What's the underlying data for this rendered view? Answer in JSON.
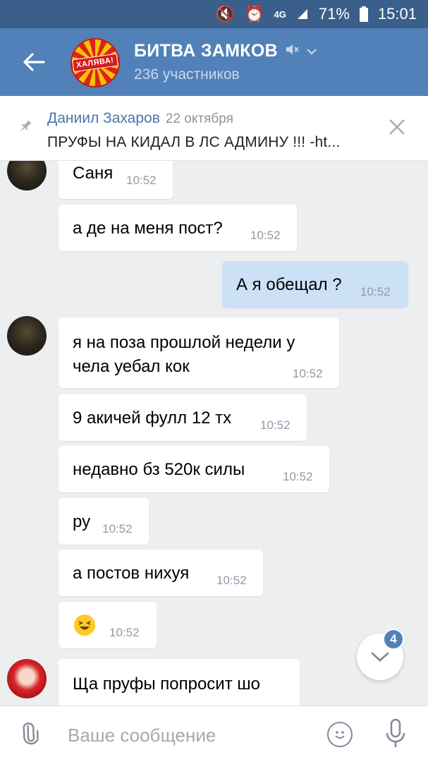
{
  "status": {
    "battery": "71%",
    "time": "15:01",
    "network": "4G"
  },
  "header": {
    "title": "БИТВА ЗАМКОВ",
    "subtitle": "236 участников",
    "avatar_text": "ХАЛЯВА!"
  },
  "pinned": {
    "author": "Даниил Захаров",
    "date": "22 октября",
    "text": "ПРУФЫ НА КИДАЛ В ЛС АДМИНУ !!! -ht..."
  },
  "messages": [
    {
      "text": "Саня",
      "time": "10:52"
    },
    {
      "text": "а де на меня пост?",
      "time": "10:52"
    },
    {
      "text": "А я обещал ?",
      "time": "10:52"
    },
    {
      "text_line1": "я на поза прошлой недели у",
      "text_line2": "чела уебал кок",
      "time": "10:52"
    },
    {
      "text": "9 акичей фулл 12 тх",
      "time": "10:52"
    },
    {
      "text": "недавно бз 520к силы",
      "time": "10:52"
    },
    {
      "text": "ру",
      "time": "10:52"
    },
    {
      "text": "а постов нихуя",
      "time": "10:52"
    },
    {
      "emoji": "laughing-face",
      "time": "10:52"
    },
    {
      "text": "Ща пруфы попросит шо"
    }
  ],
  "scroll": {
    "badge": "4"
  },
  "composer": {
    "placeholder": "Ваше сообщение"
  },
  "colors": {
    "header": "#5181b8",
    "statusbar": "#3a5f8a",
    "outgoing": "#cce1f6",
    "background": "#edeef0"
  }
}
